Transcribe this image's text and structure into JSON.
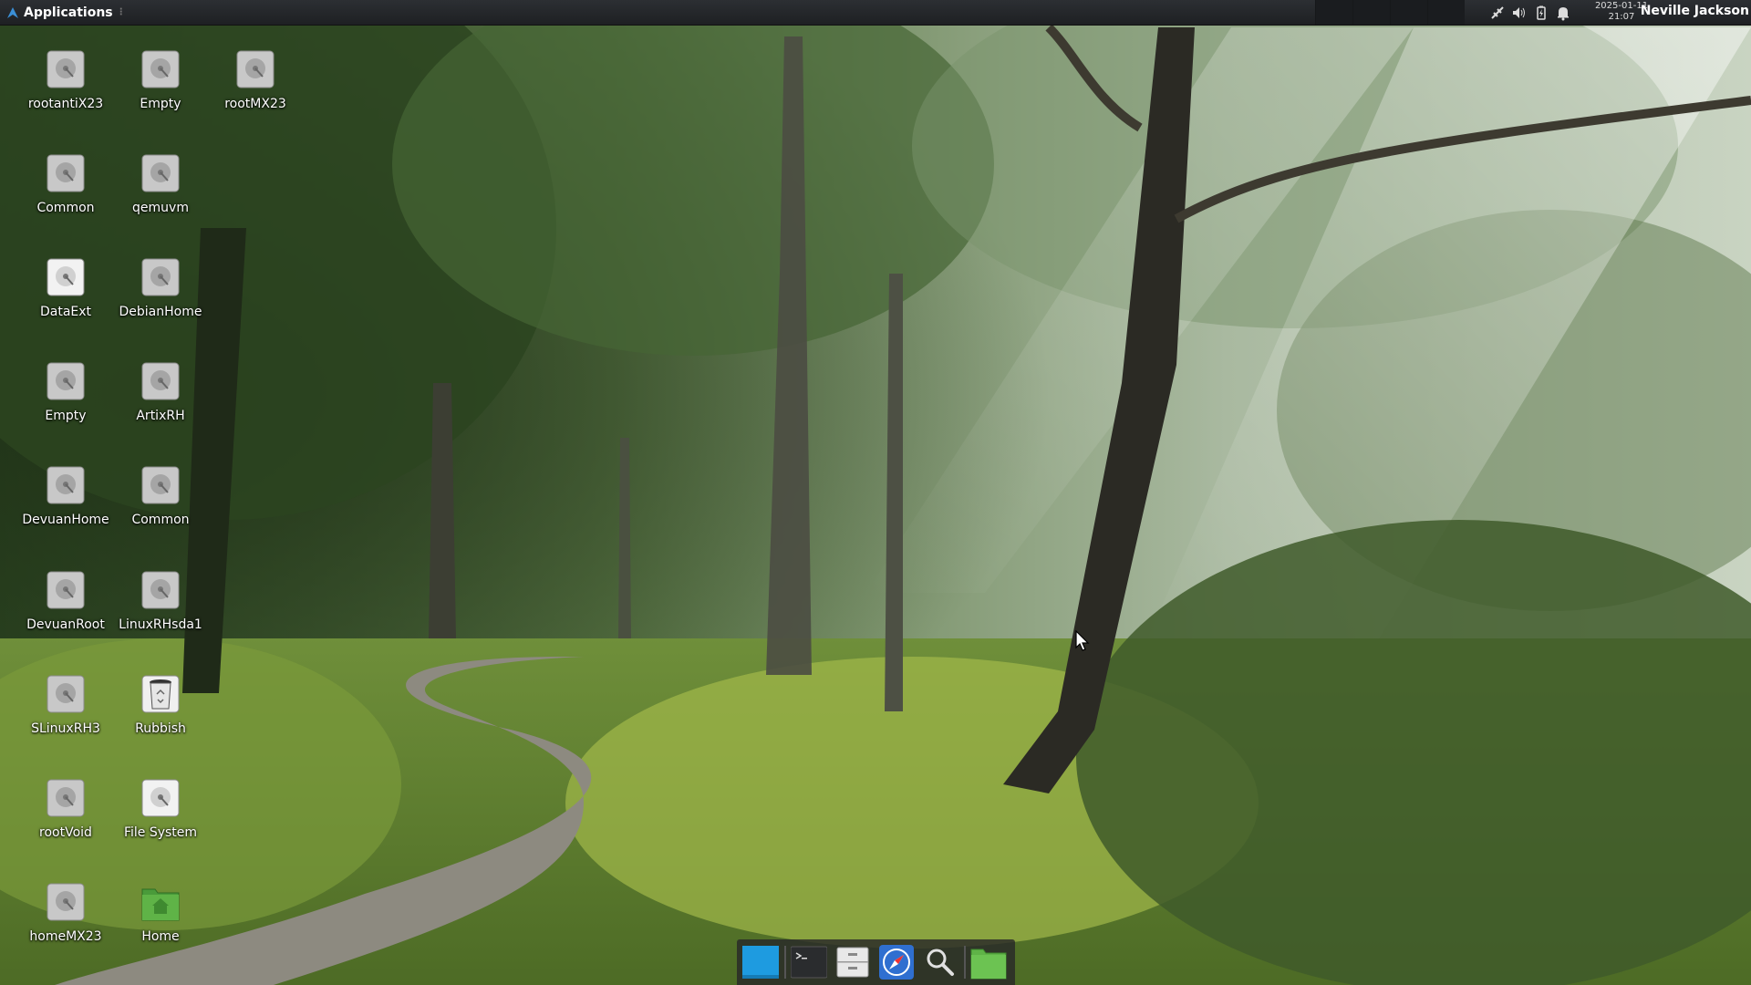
{
  "top_panel": {
    "applications_label": "Applications",
    "clock_date": "2025-01-11",
    "clock_time": "21:07",
    "user_name": "Neville Jackson"
  },
  "desktop": {
    "icons": [
      {
        "label": "rootantiX23",
        "icon": "drive-icon"
      },
      {
        "label": "Empty",
        "icon": "drive-icon"
      },
      {
        "label": "rootMX23",
        "icon": "drive-icon"
      },
      {
        "label": "Common",
        "icon": "drive-icon"
      },
      {
        "label": "qemuvm",
        "icon": "drive-icon"
      },
      {
        "label": "DataExt",
        "icon": "drive-icon"
      },
      {
        "label": "DebianHome",
        "icon": "drive-icon"
      },
      {
        "label": "Empty",
        "icon": "drive-icon"
      },
      {
        "label": "ArtixRH",
        "icon": "drive-icon"
      },
      {
        "label": "DevuanHome",
        "icon": "drive-icon"
      },
      {
        "label": "Common",
        "icon": "drive-icon"
      },
      {
        "label": "DevuanRoot",
        "icon": "drive-icon"
      },
      {
        "label": "LinuxRHsda1",
        "icon": "drive-icon"
      },
      {
        "label": "SLinuxRH3",
        "icon": "drive-icon"
      },
      {
        "label": "Rubbish",
        "icon": "trash-icon"
      },
      {
        "label": "rootVoid",
        "icon": "drive-icon"
      },
      {
        "label": "File System",
        "icon": "drive-icon"
      },
      {
        "label": "homeMX23",
        "icon": "drive-icon"
      },
      {
        "label": "Home",
        "icon": "home-folder-icon"
      }
    ]
  },
  "dock": {
    "items": [
      "show-desktop",
      "terminal",
      "file-manager",
      "web-browser",
      "app-finder",
      "files-folder"
    ]
  },
  "colors": {
    "panel_bg": "#1e2023",
    "dock_bg": "#282828",
    "accent_blue": "#1e9be0",
    "folder_green": "#5fb347"
  }
}
